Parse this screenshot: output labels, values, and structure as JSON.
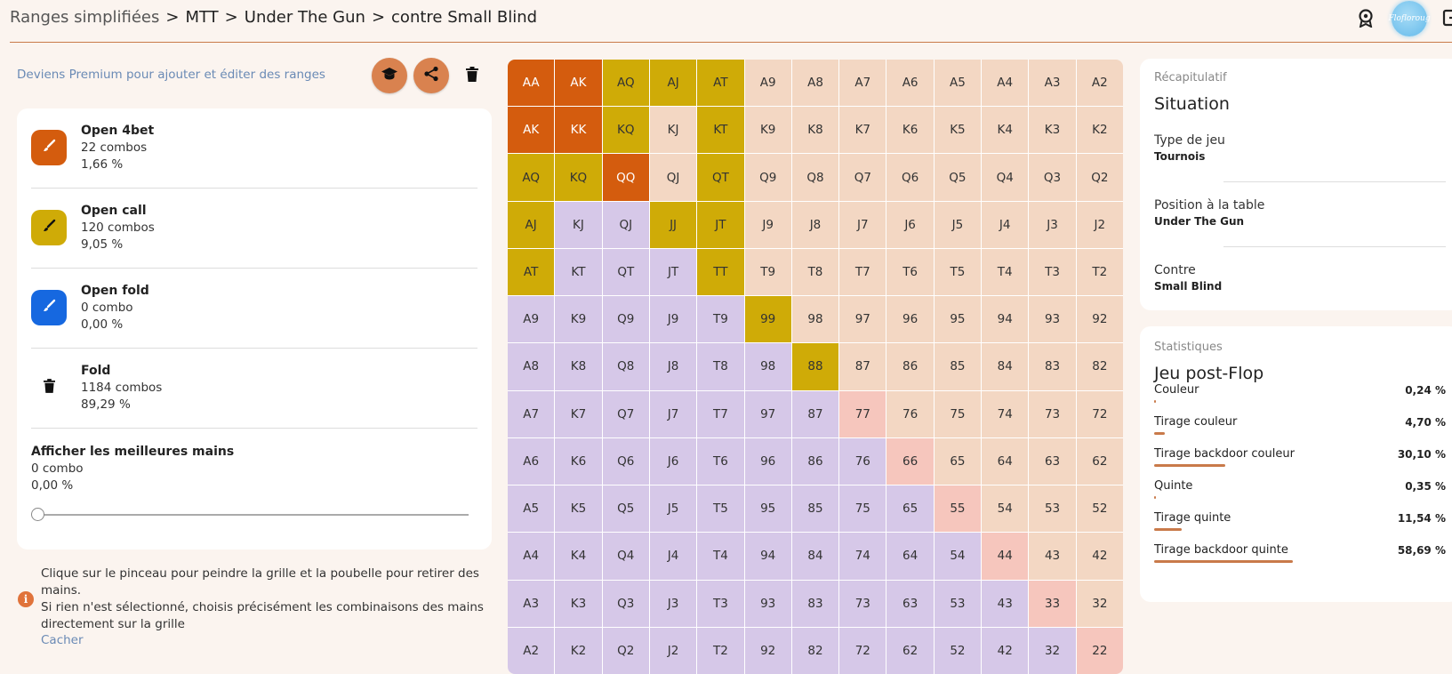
{
  "breadcrumb": {
    "root": "Ranges simplifiées",
    "sep": ">",
    "items": [
      "MTT",
      "Under The Gun",
      "contre Small Blind"
    ]
  },
  "header": {
    "avatar_text": "Flofloroug",
    "icons": [
      "award-icon",
      "logout-icon"
    ]
  },
  "colors": {
    "accent": "#d9824f",
    "open_4bet": "#d45c0e",
    "open_call": "#cfab07",
    "open_fold": "#1668e0",
    "suited": "#f3d7c3",
    "offsuit": "#d6c8e8",
    "pair": "#f6c6bd",
    "stat_bar": "#c97a4a"
  },
  "toolbar": {
    "premium_text": "Deviens Premium pour ajouter et éditer des ranges",
    "icons": [
      "graduation-cap-icon",
      "share-icon",
      "trash-icon"
    ]
  },
  "actions": [
    {
      "name": "Open 4bet",
      "combos": "22 combos",
      "pct": "1,66 %",
      "icon": "brush-icon"
    },
    {
      "name": "Open call",
      "combos": "120 combos",
      "pct": "9,05 %",
      "icon": "brush-icon"
    },
    {
      "name": "Open fold",
      "combos": "0 combo",
      "pct": "0,00 %",
      "icon": "brush-icon"
    },
    {
      "name": "Fold",
      "combos": "1184 combos",
      "pct": "89,29 %",
      "icon": "trash-icon"
    }
  ],
  "best_hands": {
    "title": "Afficher les meilleures mains",
    "combos": "0 combo",
    "pct": "0,00 %",
    "slider_value": 0
  },
  "help": {
    "line1": "Clique sur le pinceau pour peindre la grille et la poubelle pour retirer des mains.",
    "line2": "Si rien n'est sélectionné, choisis précisément les combinaisons des mains directement sur la grille",
    "hide": "Cacher"
  },
  "grid": {
    "ranks": [
      "A",
      "K",
      "Q",
      "J",
      "T",
      "9",
      "8",
      "7",
      "6",
      "5",
      "4",
      "3",
      "2"
    ],
    "open_4bet": [
      "AA",
      "AKs",
      "AKo",
      "KK",
      "QQ"
    ],
    "open_call": [
      "AQs",
      "AJs",
      "ATs",
      "KQs",
      "KTs",
      "AQo",
      "KQo",
      "QTs",
      "AJo",
      "JJ",
      "JTs",
      "ATo",
      "TT",
      "99",
      "88"
    ]
  },
  "summary": {
    "section": "Récapitulatif",
    "title": "Situation",
    "fields": [
      {
        "label": "Type de jeu",
        "value": "Tournois"
      },
      {
        "label": "Position à la table",
        "value": "Under The Gun"
      },
      {
        "label": "Contre",
        "value": "Small Blind"
      }
    ]
  },
  "stats": {
    "section": "Statistiques",
    "title": "Jeu post-Flop",
    "items": [
      {
        "label": "Couleur",
        "value": "0,24 %",
        "fraction": 0.0024
      },
      {
        "label": "Tirage couleur",
        "value": "4,70 %",
        "fraction": 0.047
      },
      {
        "label": "Tirage backdoor couleur",
        "value": "30,10 %",
        "fraction": 0.301
      },
      {
        "label": "Quinte",
        "value": "0,35 %",
        "fraction": 0.0035
      },
      {
        "label": "Tirage quinte",
        "value": "11,54 %",
        "fraction": 0.1154
      },
      {
        "label": "Tirage backdoor quinte",
        "value": "58,69 %",
        "fraction": 0.5869
      }
    ]
  }
}
